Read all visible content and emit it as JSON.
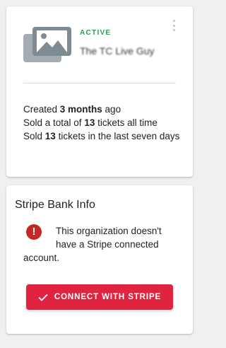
{
  "event": {
    "image_icon": "image-placeholder-icon",
    "status": "ACTIVE",
    "name": "The TC Live Guy",
    "more_icon": "more-vert-icon",
    "stats": {
      "created_prefix": "Created ",
      "created_value": "3 months",
      "created_suffix": " ago",
      "total_prefix": "Sold a total of ",
      "total_value": "13",
      "total_suffix": " tickets all time",
      "week_prefix": "Sold ",
      "week_value": "13",
      "week_suffix": " tickets in the last seven days"
    }
  },
  "stripe": {
    "title": "Stripe Bank Info",
    "alert_icon": "error-icon",
    "alert_glyph": "!",
    "message_line1": "This organization doesn't have a Stripe connected",
    "message_line2": "account.",
    "button_label": "CONNECT WITH STRIPE",
    "button_icon": "check-icon"
  },
  "colors": {
    "accent": "#e0243f",
    "status_active": "#2e9d57",
    "error": "#c62828"
  }
}
